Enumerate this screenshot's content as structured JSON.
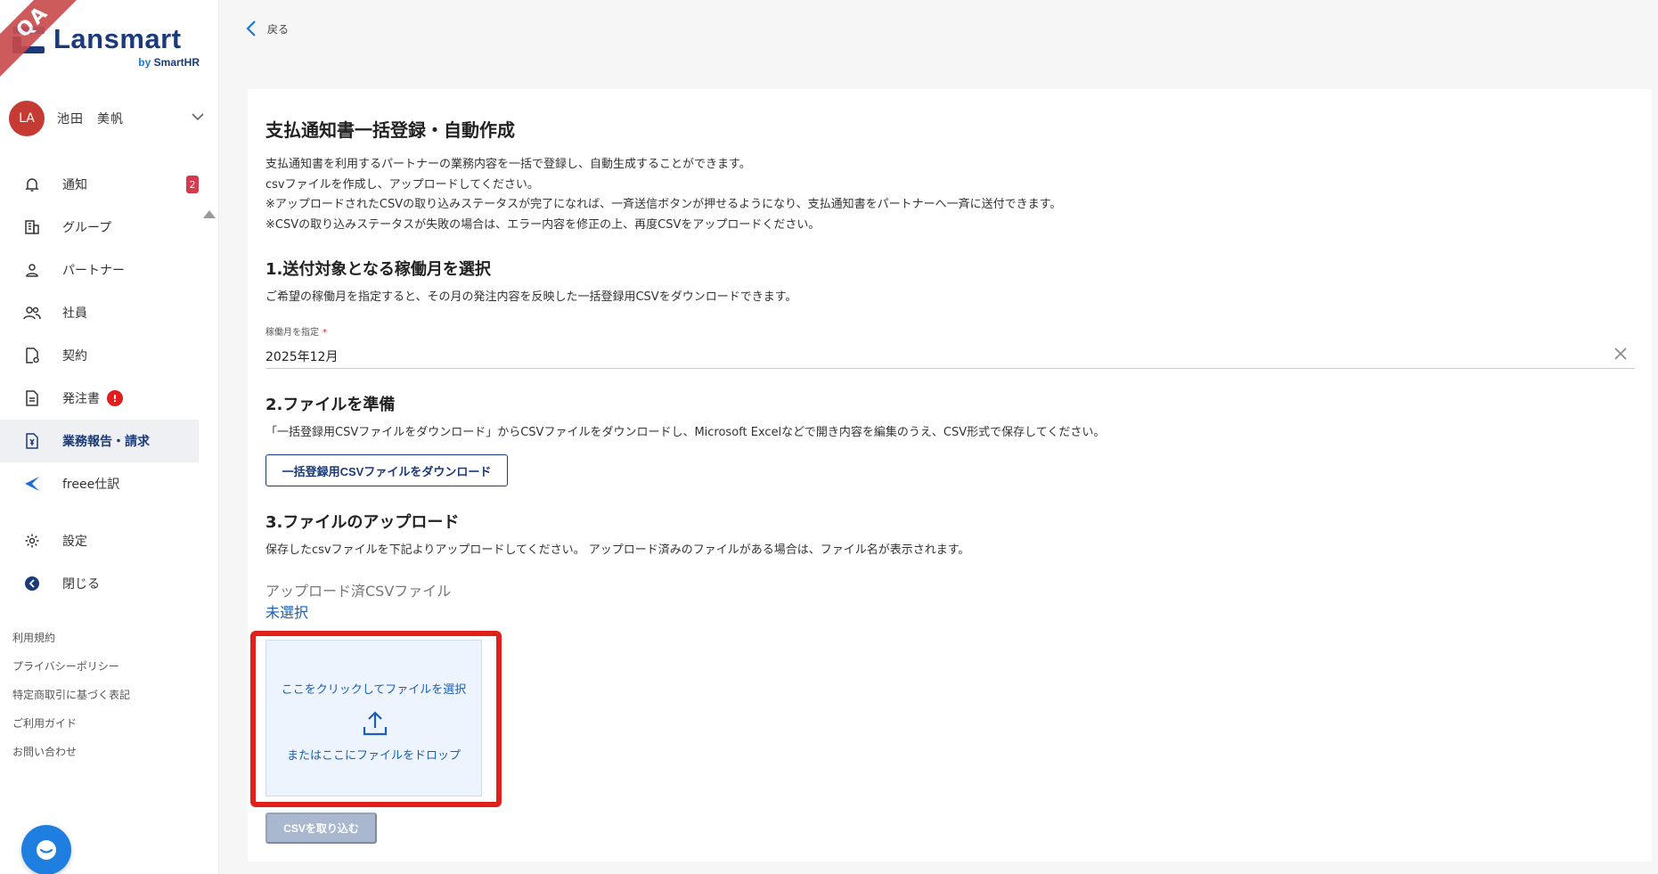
{
  "qa_ribbon": "QA",
  "brand": {
    "name": "Lansmart",
    "by": "by",
    "by_brand": "SmartHR"
  },
  "user": {
    "initials": "LA",
    "name": "池田　美帆"
  },
  "nav": [
    {
      "label": "通知",
      "icon": "bell-icon",
      "badge": "2"
    },
    {
      "label": "グループ",
      "icon": "building-icon"
    },
    {
      "label": "パートナー",
      "icon": "person-icon"
    },
    {
      "label": "社員",
      "icon": "people-icon"
    },
    {
      "label": "契約",
      "icon": "contract-icon"
    },
    {
      "label": "発注書",
      "icon": "document-icon",
      "alert": "!"
    },
    {
      "label": "業務報告・請求",
      "icon": "invoice-icon",
      "active": true
    },
    {
      "label": "freee仕訳",
      "icon": "freee-icon"
    },
    {
      "label": "設定",
      "icon": "gear-icon"
    },
    {
      "label": "閉じる",
      "icon": "arrow-left-circle-icon"
    }
  ],
  "footer_links": [
    "利用規約",
    "プライバシーポリシー",
    "特定商取引に基づく表記",
    "ご利用ガイド",
    "お問い合わせ"
  ],
  "back_label": "戻る",
  "page": {
    "title": "支払通知書一括登録・自動作成",
    "intro": [
      "支払通知書を利用するパートナーの業務内容を一括で登録し、自動生成することができます。",
      "csvファイルを作成し、アップロードしてください。",
      "※アップロードされたCSVの取り込みステータスが完了になれば、一斉送信ボタンが押せるようになり、支払通知書をパートナーへ一斉に送付できます。",
      "※CSVの取り込みステータスが失敗の場合は、エラー内容を修正の上、再度CSVをアップロードください。"
    ],
    "section1": {
      "title": "1.送付対象となる稼働月を選択",
      "desc": "ご希望の稼働月を指定すると、その月の発注内容を反映した一括登録用CSVをダウンロードできます。",
      "field_label": "稼働月を指定",
      "required_mark": "*",
      "field_value": "2025年12月"
    },
    "section2": {
      "title": "2.ファイルを準備",
      "desc": "「一括登録用CSVファイルをダウンロード」からCSVファイルをダウンロードし、Microsoft Excelなどで開き内容を編集のうえ、CSV形式で保存してください。",
      "button": "一括登録用CSVファイルをダウンロード"
    },
    "section3": {
      "title": "3.ファイルのアップロード",
      "desc": "保存したcsvファイルを下記よりアップロードしてください。 アップロード済みのファイルがある場合は、ファイル名が表示されます。",
      "uploaded_label": "アップロード済CSVファイル",
      "uploaded_value": "未選択",
      "dropzone_line1": "ここをクリックしてファイルを選択",
      "dropzone_line2": "またはここにファイルをドロップ",
      "import_button": "CSVを取り込む"
    }
  },
  "colors": {
    "brand_navy": "#1b3a7a",
    "link_blue": "#1b5fb5",
    "highlight_red": "#e0201a",
    "avatar_red": "#c53a33",
    "dropzone_bg": "#eef4fd",
    "disabled_button": "#a9b8cf"
  }
}
